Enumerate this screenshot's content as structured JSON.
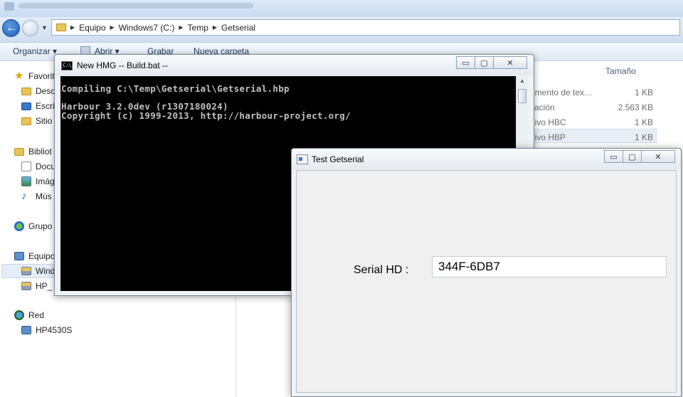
{
  "explorer": {
    "address": [
      "Equipo",
      "Windows7 (C:)",
      "Temp",
      "Getserial"
    ],
    "toolbar": {
      "organize": "Organizar ▾",
      "open": "Abrir ▾",
      "burn": "Grabar",
      "new_folder": "Nueva carpeta"
    },
    "sidebar": {
      "favorites": "Favorit",
      "desktop": "Desco",
      "escritorio": "Escri",
      "sites": "Sitio",
      "libraries": "Bibliot",
      "documents": "Docu",
      "images": "Imág",
      "music": "Mús",
      "group": "Grupo",
      "computer": "Equipo",
      "windows_drive": "Wind",
      "hp_drive": "HP_",
      "network": "Red",
      "hp_host": "HP4530S"
    },
    "columns": {
      "size": "Tamaño"
    },
    "files": [
      {
        "type": "umento de tex…",
        "size": "1 KB"
      },
      {
        "type": "cación",
        "size": "2.563 KB"
      },
      {
        "type": "nivo HBC",
        "size": "1 KB"
      },
      {
        "type": "nivo HBP",
        "size": "1 KB"
      }
    ]
  },
  "console": {
    "title": "New HMG -- Build.bat --",
    "icon_text": "C:\\",
    "lines": [
      "Compiling C:\\Temp\\Getserial\\Getserial.hbp",
      "",
      "Harbour 3.2.0dev (r1307180024)",
      "Copyright (c) 1999-2013, http://harbour-project.org/"
    ],
    "buttons": {
      "minimize": "▭",
      "maximize": "▢",
      "close": "✕"
    }
  },
  "testwin": {
    "title": "Test Getserial",
    "label": "Serial HD :",
    "value": "344F-6DB7",
    "buttons": {
      "minimize": "▭",
      "maximize": "▢",
      "close": "✕"
    }
  }
}
